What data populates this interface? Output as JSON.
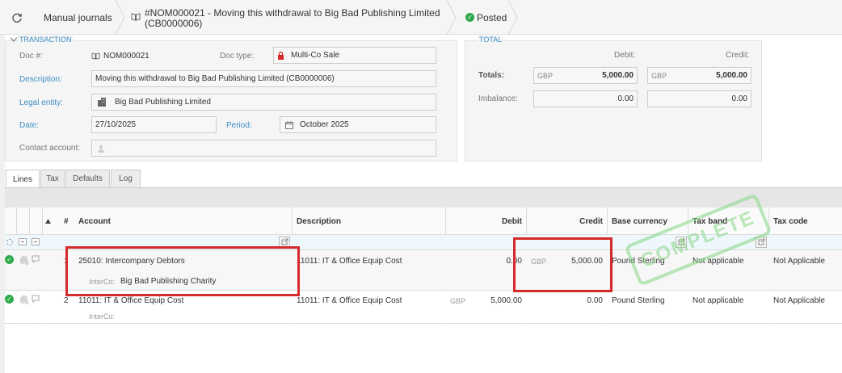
{
  "breadcrumb": {
    "root": "Manual journals",
    "record": "#NOM000021 - Moving this withdrawal to Big Bad Publishing Limited",
    "record_line2": "(CB0000006)",
    "status": "Posted"
  },
  "transaction": {
    "legend": "TRANSACTION",
    "doc_no_label": "Doc #:",
    "doc_no": "NOM000021",
    "doc_type_label": "Doc type:",
    "doc_type": "Multi-Co Sale",
    "description_label": "Description:",
    "description": "Moving this withdrawal to Big Bad Publishing Limited (CB0000006)",
    "legal_entity_label": "Legal entity:",
    "legal_entity": "Big Bad Publishing Limited",
    "date_label": "Date:",
    "date": "27/10/2025",
    "period_label": "Period:",
    "period": "October 2025",
    "contact_label": "Contact account:",
    "contact": ""
  },
  "total": {
    "legend": "TOTAL",
    "debit_label": "Debit:",
    "credit_label": "Credit:",
    "totals_label": "Totals:",
    "imbalance_label": "Imbalance:",
    "totals_debit_currency": "GBP",
    "totals_debit": "5,000.00",
    "totals_credit_currency": "GBP",
    "totals_credit": "5,000.00",
    "imbalance_debit": "0.00",
    "imbalance_credit": "0.00"
  },
  "tabs": [
    "Lines",
    "Tax",
    "Defaults",
    "Log"
  ],
  "grid": {
    "headers": {
      "hash": "#",
      "account": "Account",
      "description": "Description",
      "debit": "Debit",
      "credit": "Credit",
      "base_currency": "Base currency",
      "tax_band": "Tax band",
      "tax_code": "Tax code"
    },
    "intercompany_label": "InterCo:",
    "rows": [
      {
        "num": "1",
        "account": "25010: Intercompany Debtors",
        "interco": "Big Bad Publishing Charity",
        "description": "11011: IT & Office Equip Cost",
        "debit": "0.00",
        "credit_currency": "GBP",
        "credit": "5,000.00",
        "base_currency": "Pound Sterling",
        "tax_band": "Not applicable",
        "tax_code": "Not Applicable"
      },
      {
        "num": "2",
        "account": "11011: IT & Office Equip Cost",
        "interco": "",
        "description": "11011: IT & Office Equip Cost",
        "debit_currency": "GBP",
        "debit": "5,000.00",
        "credit": "0.00",
        "base_currency": "Pound Sterling",
        "tax_band": "Not applicable",
        "tax_code": "Not Applicable"
      }
    ]
  },
  "stamp": "COMPLETE",
  "colors": {
    "link": "#3c8dc4",
    "posted": "#2eaa4a",
    "highlight": "#d42a2a",
    "stamp": "#8fd98f"
  }
}
